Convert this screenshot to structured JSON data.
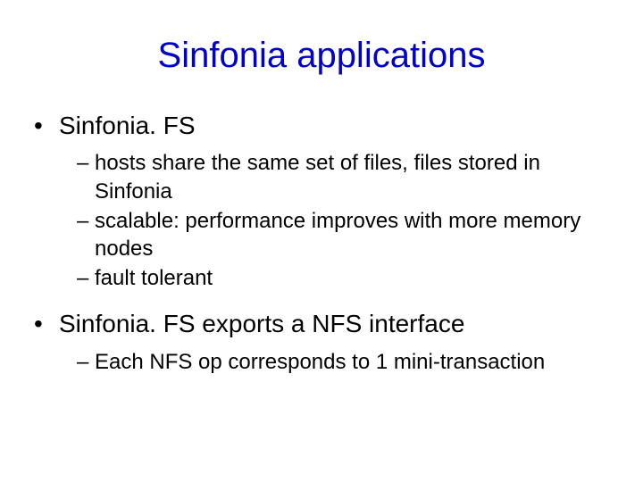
{
  "title": "Sinfonia applications",
  "sections": [
    {
      "heading": "Sinfonia. FS",
      "sub": [
        "hosts share the same set of files, files stored in Sinfonia",
        "scalable: performance improves with more memory nodes",
        "fault tolerant"
      ]
    },
    {
      "heading": "Sinfonia. FS exports a NFS interface",
      "sub": [
        "Each NFS op corresponds to 1 mini-transaction"
      ]
    }
  ]
}
